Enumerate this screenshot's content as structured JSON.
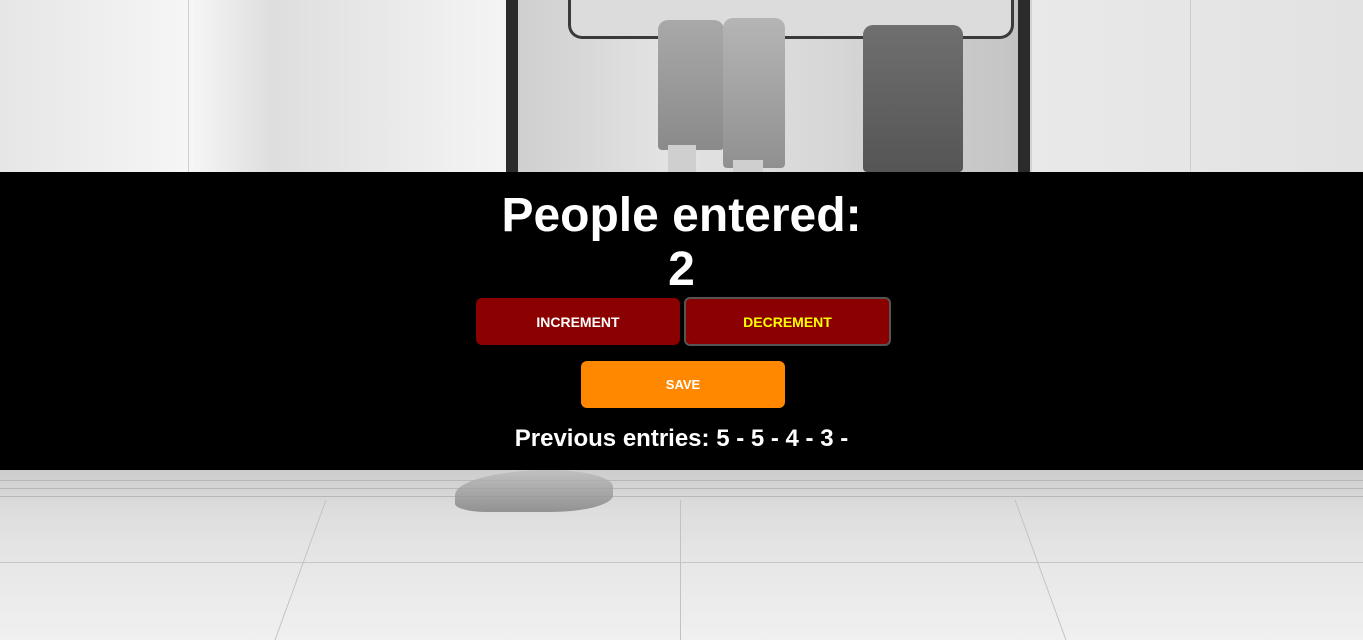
{
  "counter": {
    "heading": "People entered:",
    "count": "2"
  },
  "buttons": {
    "increment_label": "INCREMENT",
    "decrement_label": "DECREMENT",
    "save_label": "SAVE"
  },
  "history": {
    "label": "Previous entries:",
    "entries": "5 - 5 - 4 - 3 -"
  },
  "colors": {
    "panel_background": "#000000",
    "counter_button": "#8b0000",
    "save_button": "#ff8800",
    "decrement_text": "#ffff00"
  },
  "background": {
    "description_icon": "subway-platform-photo"
  }
}
